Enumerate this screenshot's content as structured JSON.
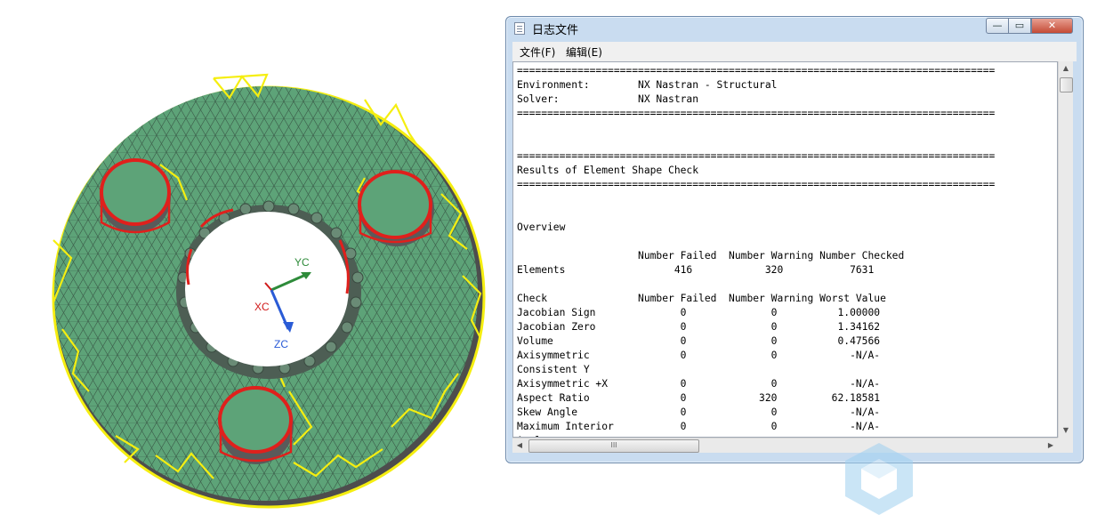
{
  "viewport": {
    "axes": {
      "yc": "YC",
      "xc": "XC",
      "zc": "ZC"
    },
    "colors": {
      "mesh_fill": "#5da378",
      "mesh_line": "#3a5a48",
      "failed": "#e0201c",
      "warning": "#f5ee10"
    }
  },
  "window": {
    "title": "日志文件",
    "controls": {
      "minimize": "—",
      "maximize": "▭",
      "close": "✕"
    },
    "menu": {
      "file": "文件(F)",
      "edit": "编辑(E)"
    },
    "log_lines": [
      "===============================================================================",
      "Environment:        NX Nastran - Structural",
      "Solver:             NX Nastran",
      "===============================================================================",
      "",
      "",
      "===============================================================================",
      "Results of Element Shape Check",
      "===============================================================================",
      "",
      "",
      "Overview",
      "",
      "                    Number Failed  Number Warning Number Checked",
      "Elements                  416            320           7631",
      "",
      "Check               Number Failed  Number Warning Worst Value",
      "Jacobian Sign              0              0          1.00000",
      "Jacobian Zero              0              0          1.34162",
      "Volume                     0              0          0.47566",
      "Axisymmetric               0              0            -N/A-",
      "Consistent Y",
      "Axisymmetric +X            0              0            -N/A-",
      "Aspect Ratio               0            320         62.18581",
      "Skew Angle                 0              0            -N/A-",
      "Maximum Interior           0              0            -N/A-",
      "Angle"
    ],
    "scroll": {
      "up": "▲",
      "down": "▼",
      "left": "◀",
      "right": "▶",
      "thumb_grip": "III"
    }
  }
}
